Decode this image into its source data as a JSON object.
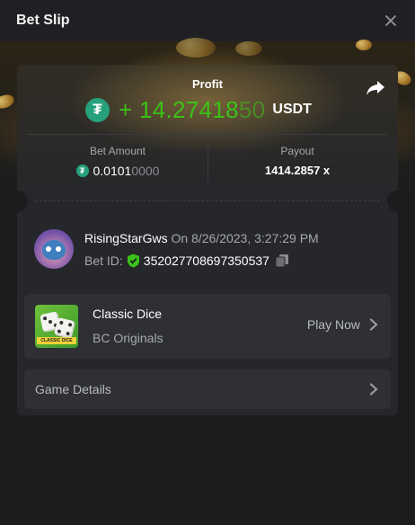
{
  "header": {
    "title": "Bet Slip"
  },
  "profit": {
    "label": "Profit",
    "prefix": "+",
    "value_main": "14.27418",
    "value_dim": "50",
    "unit": "USDT",
    "currency_symbol": "₮"
  },
  "stats": {
    "bet_amount_label": "Bet Amount",
    "bet_amount_main": "0.0101",
    "bet_amount_dim": "0000",
    "payout_label": "Payout",
    "payout_value": "1414.2857 x"
  },
  "bet": {
    "username": "RisingStarGws",
    "date_prefix": "On",
    "date": "8/26/2023, 3:27:29 PM",
    "bet_id_label": "Bet ID:",
    "bet_id": "352027708697350537"
  },
  "game": {
    "name": "Classic Dice",
    "provider": "BC Originals",
    "thumb_tag": "CLASSIC DICE",
    "play_label": "Play Now"
  },
  "details": {
    "label": "Game Details"
  },
  "colors": {
    "profit_green": "#3bc117",
    "tether_green": "#26a17b",
    "shield_green": "#3bc117"
  }
}
